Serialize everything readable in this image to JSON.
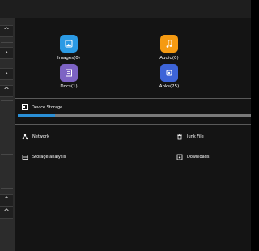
{
  "rail": {
    "up_glyph": "^",
    "next_glyph": "›"
  },
  "categories": [
    {
      "label": "Images(0)",
      "icon": "image-icon",
      "color": "#2b9ae4"
    },
    {
      "label": "Audio(0)",
      "icon": "music-note-icon",
      "color": "#f59a12"
    },
    {
      "label": "Docs(1)",
      "icon": "document-icon",
      "color": "#7d63c4"
    },
    {
      "label": "Apks(25)",
      "icon": "android-package-icon",
      "color": "#3d64d8"
    }
  ],
  "storage": {
    "label": "Device Storage",
    "used_fraction": 0.16,
    "accent": "#2a8fd6"
  },
  "tools": [
    {
      "label": "Network",
      "icon": "network-icon"
    },
    {
      "label": "Junk File",
      "icon": "trash-icon"
    },
    {
      "label": "Storage analysis",
      "icon": "storage-analysis-icon"
    },
    {
      "label": "Downloads",
      "icon": "download-icon"
    }
  ]
}
